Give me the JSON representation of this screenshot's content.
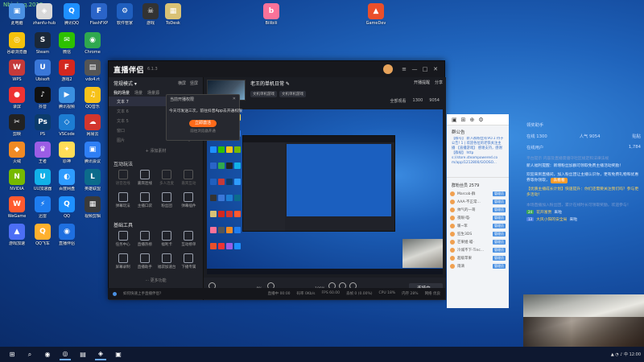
{
  "desktop": {
    "watermark": "Nbird.cq.2018",
    "icons": [
      {
        "label": "此电脑",
        "color": "#4a90e2",
        "glyph": "▣"
      },
      {
        "label": "zhanfu-hub",
        "color": "#d9d9d9",
        "glyph": "◈"
      },
      {
        "label": "腾讯QQ",
        "color": "#1e90ff",
        "glyph": "Q"
      },
      {
        "label": "FlashFXP",
        "color": "#2a64c8",
        "glyph": "F"
      },
      {
        "label": "软件管家",
        "color": "#1f5fbf",
        "glyph": "⚙"
      },
      {
        "label": "游戏",
        "color": "#333",
        "glyph": "☠"
      },
      {
        "label": "ToDesk",
        "color": "#d9c275",
        "glyph": "▦"
      },
      {
        "label": "Bilibili",
        "color": "#fb7299",
        "glyph": "b"
      },
      {
        "label": "GameDev",
        "color": "#e94f2b",
        "glyph": "▲"
      },
      {
        "label": "谷歌浏览器",
        "color": "#f4c20d",
        "glyph": "◎"
      },
      {
        "label": "Steam",
        "color": "#1b2838",
        "glyph": "S"
      },
      {
        "label": "微信",
        "color": "#2dc100",
        "glyph": "✉"
      },
      {
        "label": "Chrome",
        "color": "#2fa84f",
        "glyph": "◉"
      },
      {
        "label": "WPS",
        "color": "#c53a3a",
        "glyph": "W"
      },
      {
        "label": "Ubisoft",
        "color": "#3a77d8",
        "glyph": "U"
      },
      {
        "label": "游戏2",
        "color": "#d3271f",
        "glyph": "F"
      },
      {
        "label": "vdo4.rt",
        "color": "#555",
        "glyph": "▤"
      },
      {
        "label": "录屏",
        "color": "#e33",
        "glyph": "●"
      },
      {
        "label": "抖音",
        "color": "#111",
        "glyph": "♪"
      },
      {
        "label": "腾讯视频",
        "color": "#3a8fe0",
        "glyph": "▶"
      },
      {
        "label": "QQ音乐",
        "color": "#f7c21b",
        "glyph": "♫"
      },
      {
        "label": "剪映",
        "color": "#222",
        "glyph": "✂"
      },
      {
        "label": "PS",
        "color": "#0c3b6b",
        "glyph": "Ps"
      },
      {
        "label": "VSCode",
        "color": "#1d7dd3",
        "glyph": "◇"
      },
      {
        "label": "网易云",
        "color": "#d3362e",
        "glyph": "☁"
      },
      {
        "label": "火绒",
        "color": "#f08a24",
        "glyph": "◆"
      },
      {
        "label": "王者",
        "color": "#9b5de5",
        "glyph": "♛"
      },
      {
        "label": "原神",
        "color": "#ffdd57",
        "glyph": "✦"
      },
      {
        "label": "腾讯会议",
        "color": "#2e7ff5",
        "glyph": "▣"
      },
      {
        "label": "NVIDIA",
        "color": "#76b900",
        "glyph": "N"
      },
      {
        "label": "UU加速器",
        "color": "#12b1e8",
        "glyph": "U"
      },
      {
        "label": "百度网盘",
        "color": "#2e9cff",
        "glyph": "◐"
      },
      {
        "label": "英雄联盟",
        "color": "#0c6b8b",
        "glyph": "L"
      },
      {
        "label": "WeGame",
        "color": "#ff5a2f",
        "glyph": "W"
      },
      {
        "label": "迅雷",
        "color": "#1e7df0",
        "glyph": "⚡"
      },
      {
        "label": "QQ",
        "color": "#1e90ff",
        "glyph": "Q"
      },
      {
        "label": "视频剪辑",
        "color": "#3a3a3a",
        "glyph": "▦"
      },
      {
        "label": "游戏加速",
        "color": "#4c6ef5",
        "glyph": "▲"
      },
      {
        "label": "QQ飞车",
        "color": "#ffb02e",
        "glyph": "Q"
      },
      {
        "label": "直播伴侣",
        "color": "#1e6fe0",
        "glyph": "◉"
      }
    ]
  },
  "app": {
    "logo": "直播伴侣",
    "version": "6.1.3",
    "left": {
      "mode_label": "常规模式 ▾",
      "tab_a": "横屏",
      "tab_b": "竖屏",
      "scene_tabs": [
        "我的场景",
        "场景",
        "场景源"
      ],
      "sources": [
        "文本 7",
        "文本 6",
        "文本 5",
        "窗口",
        "图片"
      ],
      "add_source": "+ 添加素材",
      "interactive_title": "互动玩法",
      "interactive_tools": [
        "语音连线",
        "嘉宾连线",
        "多人连麦",
        "嘉宾互动",
        "弹幕玩法",
        "主播口袋",
        "粉丝团",
        "弹幕插件"
      ],
      "basic_title": "基础工具",
      "basic_tools": [
        "任务中心",
        "直播热榜",
        "福利卡",
        "互动榜单",
        "屏幕录制",
        "直播助手",
        "福袋加速台",
        "下播专属"
      ],
      "more": "··· 更多功能"
    },
    "room": {
      "title": "老王的单机日常 ✎",
      "thumb_caption": "点击修改直播封面",
      "tags": [
        "文机单机游戏",
        "文机单机游戏"
      ],
      "top_right": [
        "开播提醒",
        "分享"
      ],
      "stats": [
        "全部观看",
        "1300",
        "9054"
      ]
    },
    "preview": {
      "dialog_title": "当前开播权限",
      "dialog_msg": "今天可发送三次，前往抖音App去开通权限",
      "dialog_button": "立即激活",
      "dialog_link": "前往浏览器开通"
    },
    "controls": {
      "mic_label": "麦克风",
      "mic_pct": "0%",
      "mic_level": 0.04,
      "speaker_label": "扬声器",
      "speaker_pct": "100%",
      "speaker_level": 1.0,
      "beauty": "美颜",
      "more": "更多",
      "settings": "设置",
      "go_live": "连接中..."
    },
    "footer": {
      "left": "如何快速上手直播伴侣?",
      "items": [
        "直播中 00:00",
        "码率 0Kb/s",
        "FPS 60.00",
        "丢帧 0 (0.00%)",
        "CPU 18%",
        "内存 28%",
        "网络 优良"
      ]
    }
  },
  "chat": {
    "top_icons": [
      "▣",
      "⊞",
      "⊕",
      "⚙"
    ],
    "notice_title": "群公告",
    "notice": "【群号】 新入群粉丝有VO.1 待子公告! 1 | 欢迎各位的老铁关注主播 【直播游戏】 感谢支持，感谢 【群规】 http s://store.steampowered.co m/app/1212800/GOOSO...",
    "fans_title": "群粉丝员 2579",
    "members": [
      {
        "name": "Marcob·群",
        "badge": "管理员"
      },
      {
        "name": "AAA-不正常...",
        "badge": "管理员"
      },
      {
        "name": "帅气的一哥",
        "badge": "管理员"
      },
      {
        "name": "夜眼·喵·",
        "badge": "管理员"
      },
      {
        "name": "暖~笨",
        "badge": "管理员"
      },
      {
        "name": "狂生3DS",
        "badge": "管理员"
      },
      {
        "name": "芒果姐·喵·",
        "badge": "管理员"
      },
      {
        "name": "冷城不下-Tinc...",
        "badge": "管理员"
      },
      {
        "name": "超级苹果",
        "badge": "管理员"
      },
      {
        "name": "雨滴",
        "badge": "管理员"
      }
    ]
  },
  "info": {
    "title": "领奖助手",
    "online_label": "在线",
    "online": "1300",
    "hot_label": "人气",
    "hot": "9054",
    "rank_label": "在线用户",
    "rank_value": "1,784",
    "extra": "贴贴",
    "desc": "平台提示 内容及直播需遵守社区规定和法律法规",
    "msg1": "新人福利提醒：新增粉丝加群可领取免费主播活动奖励！",
    "msg2": "欢迎来到直播间，加入粉丝团让主播认识你，更有免费礼物和优惠券等你领取，",
    "highlight": "去看看",
    "msg3": "【优质主播成长计划】快速提升：你们还需要关注我们吗？参与更多活动！",
    "msg4": "本场直播加入粉丝团，累计在线时长可领取奖励，欢迎参与！",
    "line1_lv": "24",
    "line1_name": "花开富贵",
    "line1_text": "来啦",
    "line2_lv": "13",
    "line2_name": "大风小阳的安全局",
    "line2_text": "来啦"
  },
  "taskbar": {
    "items": [
      "⊞",
      "⌕",
      "◉",
      "◎",
      "▤",
      "◈",
      "▣"
    ],
    "tray": "▲ ◔ ♪ 中 12:00"
  }
}
